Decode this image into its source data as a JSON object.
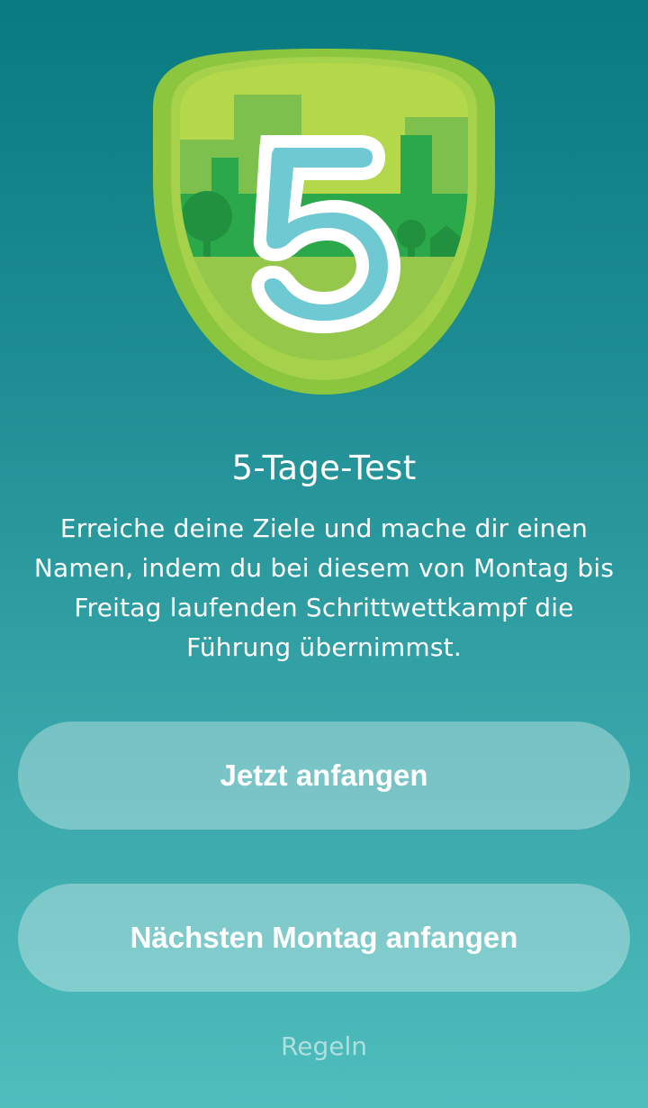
{
  "badge": {
    "icon": "five-day-test-badge-icon",
    "digit": "5",
    "colors": {
      "rim": "#8cc63f",
      "sky": "#b5d84a",
      "buildings": "#7dc04d",
      "trees": "#2aa84a",
      "ground": "#95c84a",
      "digit_fill": "#6fc9d2",
      "digit_outline": "#ffffff"
    }
  },
  "challenge": {
    "title": "5-Tage-Test",
    "description": "Erreiche deine Ziele und mache dir einen Namen, indem du bei diesem von Montag bis Freitag laufenden Schrittwettkampf die Führung übernimmst."
  },
  "actions": {
    "start_now_label": "Jetzt anfangen",
    "start_next_monday_label": "Nächsten Montag anfangen",
    "rules_label": "Regeln"
  },
  "theme": {
    "gradient_top": "#087a80",
    "gradient_bottom": "#4fbdbc"
  }
}
